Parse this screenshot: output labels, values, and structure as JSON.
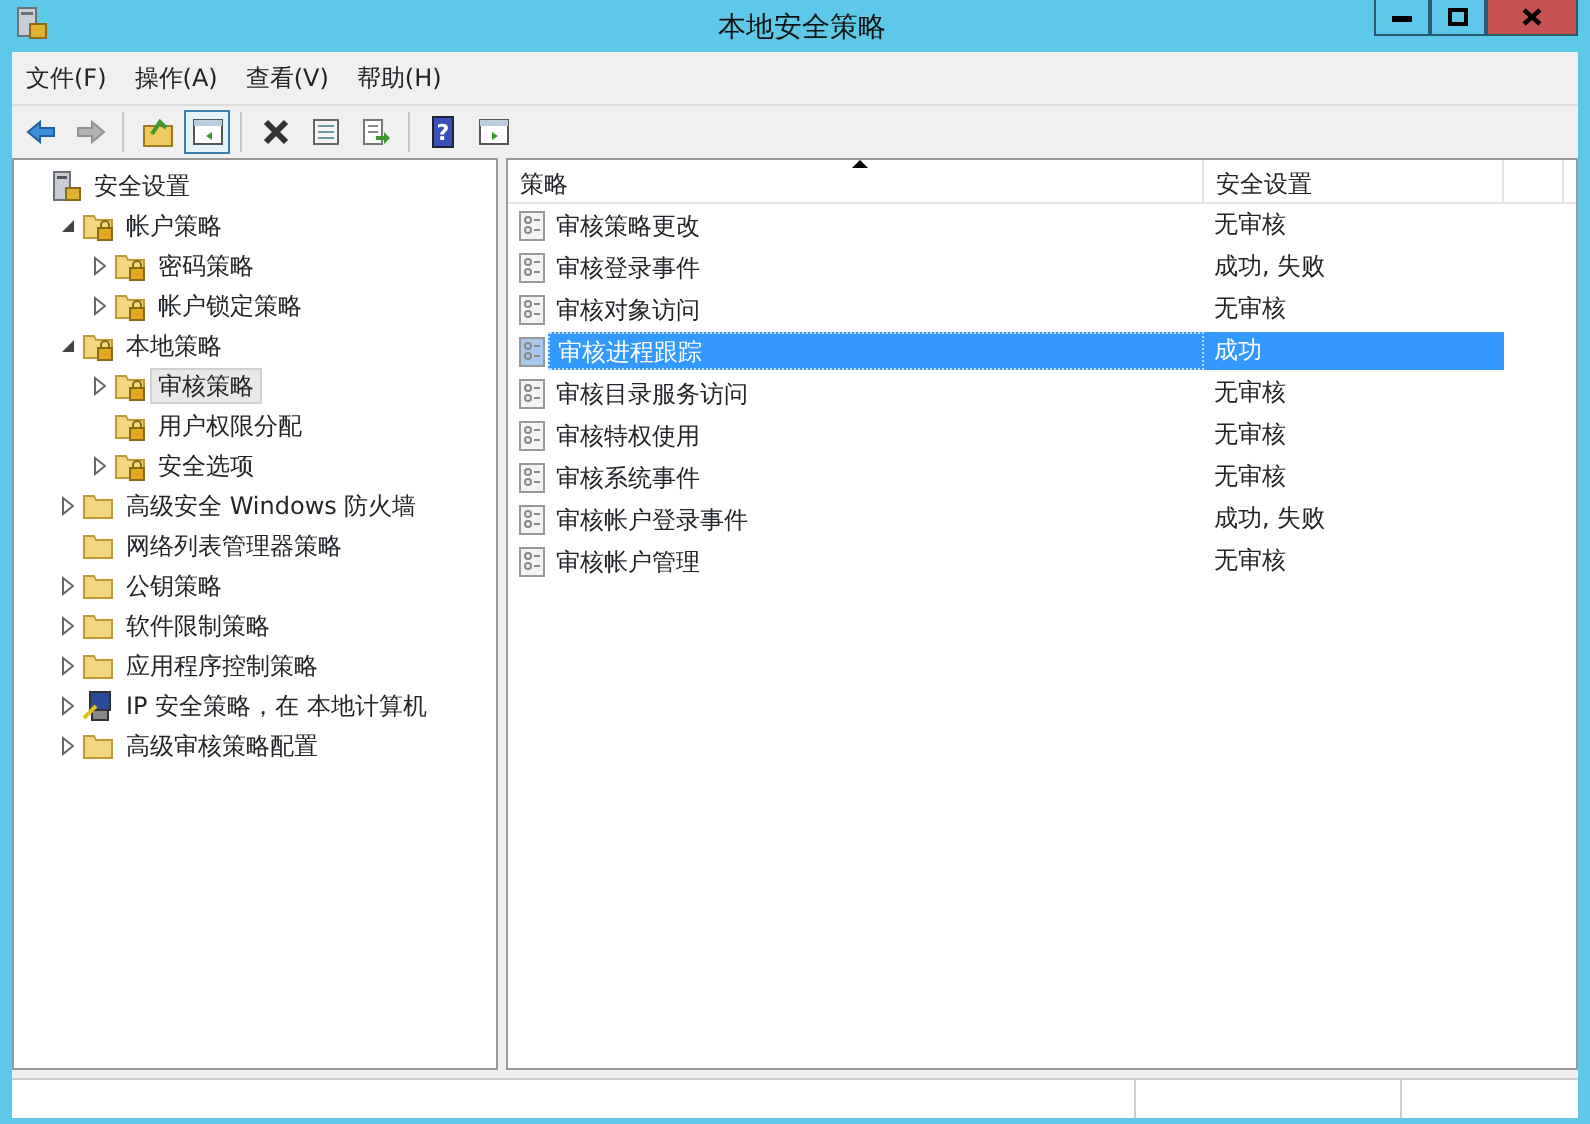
{
  "window": {
    "title": "本地安全策略"
  },
  "menu": [
    "文件(F)",
    "操作(A)",
    "查看(V)",
    "帮助(H)"
  ],
  "toolbar": [
    {
      "kind": "back",
      "disabled": false,
      "pressed": false
    },
    {
      "kind": "forward",
      "disabled": true,
      "pressed": false
    },
    {
      "kind": "sep"
    },
    {
      "kind": "up",
      "disabled": false,
      "pressed": false
    },
    {
      "kind": "tree",
      "disabled": false,
      "pressed": true
    },
    {
      "kind": "sep"
    },
    {
      "kind": "delete",
      "disabled": false,
      "pressed": false
    },
    {
      "kind": "properties",
      "disabled": false,
      "pressed": false
    },
    {
      "kind": "export",
      "disabled": false,
      "pressed": false
    },
    {
      "kind": "sep"
    },
    {
      "kind": "help",
      "text": "?",
      "disabled": false,
      "pressed": false
    },
    {
      "kind": "actions",
      "disabled": false,
      "pressed": false
    }
  ],
  "tree": [
    {
      "label": "安全设置",
      "kind": "server",
      "selected": false,
      "children": [
        {
          "label": "帐户策略",
          "kind": "lockfolder",
          "expanded": true,
          "selected": false,
          "children": [
            {
              "label": "密码策略",
              "kind": "lockfolder",
              "expanded": false,
              "selected": false
            },
            {
              "label": "帐户锁定策略",
              "kind": "lockfolder",
              "expanded": false,
              "selected": false
            }
          ]
        },
        {
          "label": "本地策略",
          "kind": "lockfolder",
          "expanded": true,
          "selected": false,
          "children": [
            {
              "label": "审核策略",
              "kind": "lockfolder",
              "expanded": false,
              "selected": true
            },
            {
              "label": "用户权限分配",
              "kind": "lockfolder",
              "selected": false
            },
            {
              "label": "安全选项",
              "kind": "lockfolder",
              "expanded": false,
              "selected": false
            }
          ]
        },
        {
          "label": "高级安全 Windows 防火墙",
          "kind": "folder",
          "expanded": false,
          "selected": false
        },
        {
          "label": "网络列表管理器策略",
          "kind": "folder",
          "selected": false
        },
        {
          "label": "公钥策略",
          "kind": "folder",
          "expanded": false,
          "selected": false
        },
        {
          "label": "软件限制策略",
          "kind": "folder",
          "expanded": false,
          "selected": false
        },
        {
          "label": "应用程序控制策略",
          "kind": "folder",
          "expanded": false,
          "selected": false
        },
        {
          "label": "IP 安全策略，在 本地计算机",
          "kind": "ipsec",
          "expanded": false,
          "selected": false
        },
        {
          "label": "高级审核策略配置",
          "kind": "folder",
          "expanded": false,
          "selected": false
        }
      ]
    }
  ],
  "table": {
    "columns": [
      {
        "label": "策略",
        "sorted": true
      },
      {
        "label": "安全设置"
      }
    ],
    "rows": [
      {
        "policy": "审核策略更改",
        "setting": "无审核",
        "selected": false
      },
      {
        "policy": "审核登录事件",
        "setting": "成功, 失败",
        "selected": false
      },
      {
        "policy": "审核对象访问",
        "setting": "无审核",
        "selected": false
      },
      {
        "policy": "审核进程跟踪",
        "setting": "成功",
        "selected": true
      },
      {
        "policy": "审核目录服务访问",
        "setting": "无审核",
        "selected": false
      },
      {
        "policy": "审核特权使用",
        "setting": "无审核",
        "selected": false
      },
      {
        "policy": "审核系统事件",
        "setting": "无审核",
        "selected": false
      },
      {
        "policy": "审核帐户登录事件",
        "setting": "成功, 失败",
        "selected": false
      },
      {
        "policy": "审核帐户管理",
        "setting": "无审核",
        "selected": false
      }
    ]
  }
}
